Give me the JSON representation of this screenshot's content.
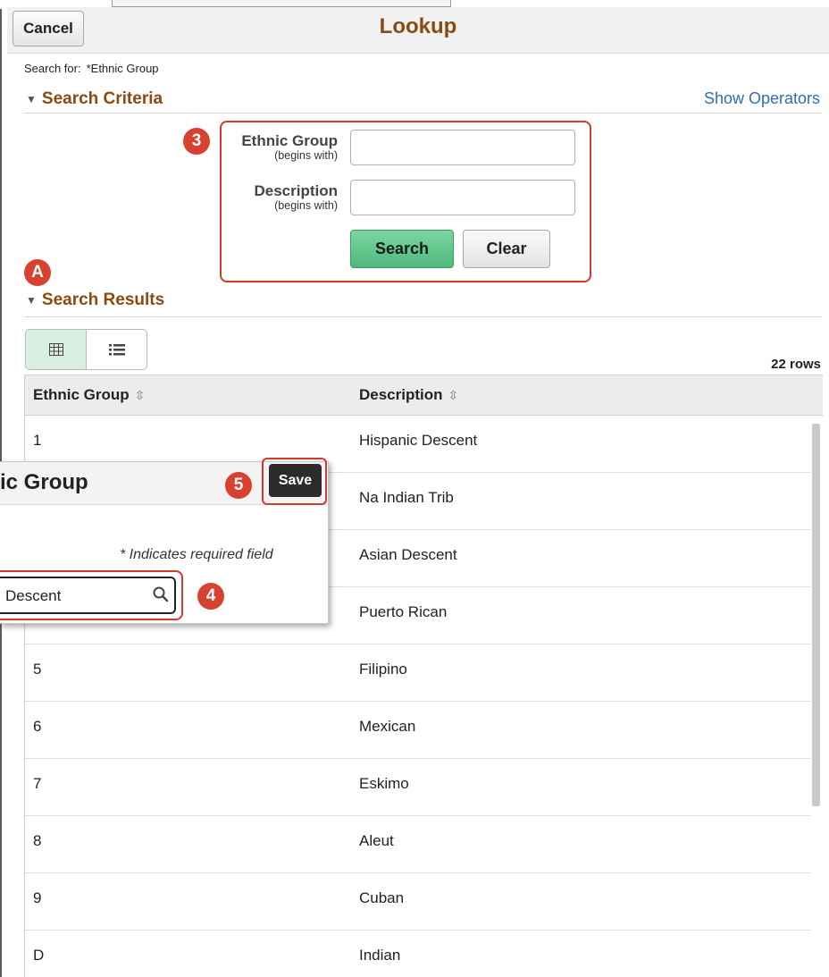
{
  "header": {
    "cancel_label": "Cancel",
    "title": "Lookup"
  },
  "search_for": {
    "label": "Search for:",
    "value": "*Ethnic Group"
  },
  "search_criteria": {
    "title": "Search Criteria",
    "show_operators": "Show Operators",
    "fields": [
      {
        "label": "Ethnic Group",
        "hint": "(begins with)",
        "value": ""
      },
      {
        "label": "Description",
        "hint": "(begins with)",
        "value": ""
      }
    ],
    "search_label": "Search",
    "clear_label": "Clear"
  },
  "badges": {
    "step3": "3",
    "stepA": "A",
    "step5": "5",
    "step4": "4"
  },
  "search_results": {
    "title": "Search Results",
    "row_count": "22 rows",
    "columns": [
      "Ethnic Group",
      "Description"
    ],
    "rows": [
      [
        "1",
        "Hispanic Descent"
      ],
      [
        "",
        "Na Indian Trib"
      ],
      [
        "",
        "Asian Descent"
      ],
      [
        "",
        "Puerto Rican"
      ],
      [
        "5",
        "Filipino"
      ],
      [
        "6",
        "Mexican"
      ],
      [
        "7",
        "Eskimo"
      ],
      [
        "8",
        "Aleut"
      ],
      [
        "9",
        "Cuban"
      ],
      [
        "D",
        "Indian"
      ]
    ]
  },
  "popup": {
    "title": "ic Group",
    "save_label": "Save",
    "required_note": "* Indicates required field",
    "field_value": "Descent"
  },
  "colors": {
    "section_title": "#8a4a12",
    "badge": "#d8412f",
    "search_button": "#5cc389",
    "link": "#2f6fb0"
  }
}
